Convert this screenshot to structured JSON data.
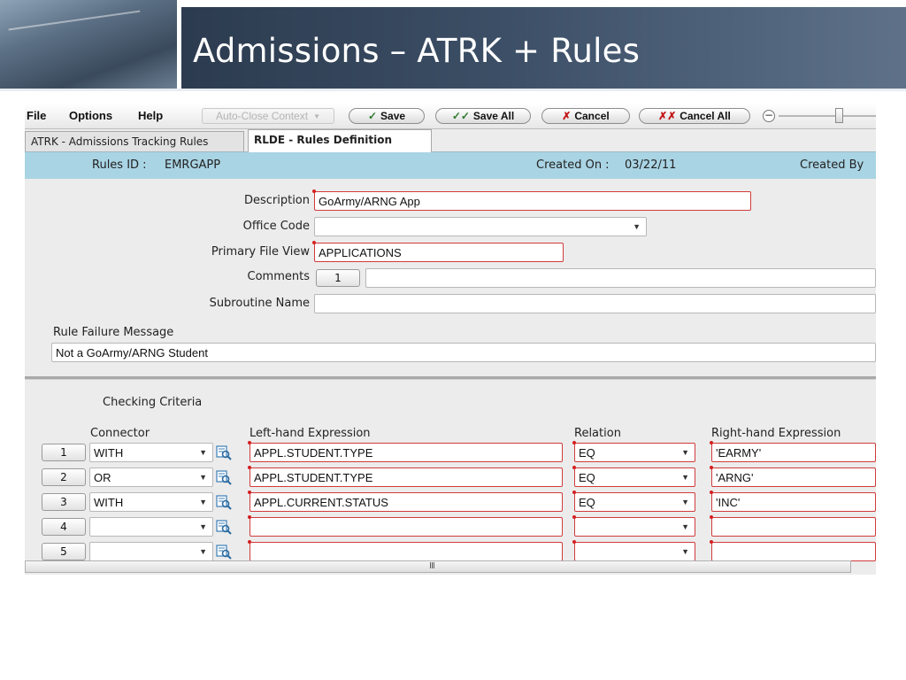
{
  "slide": {
    "title": "Admissions – ATRK + Rules"
  },
  "menu": {
    "file": "File",
    "options": "Options",
    "help": "Help"
  },
  "toolbar": {
    "auto_close": "Auto-Close Context",
    "save": "Save",
    "save_all": "Save All",
    "cancel": "Cancel",
    "cancel_all": "Cancel All",
    "collapse": "−"
  },
  "tabs": [
    {
      "label": "ATRK - Admissions Tracking Rules"
    },
    {
      "label": "RLDE - Rules Definition"
    }
  ],
  "header": {
    "rules_id_label": "Rules ID :",
    "rules_id": "EMRGAPP",
    "created_on_label": "Created On :",
    "created_on": "03/22/11",
    "created_by_label": "Created By"
  },
  "form": {
    "description_label": "Description",
    "description": "GoArmy/ARNG App",
    "office_code_label": "Office Code",
    "office_code": "",
    "primary_file_view_label": "Primary File View",
    "primary_file_view": "APPLICATIONS",
    "comments_label": "Comments",
    "comments_count": "1",
    "comments": "",
    "subroutine_name_label": "Subroutine Name",
    "subroutine_name": "",
    "rule_failure_message_label": "Rule Failure Message",
    "rule_failure_message": "Not a GoArmy/ARNG Student"
  },
  "criteria": {
    "title": "Checking Criteria",
    "headers": {
      "connector": "Connector",
      "left": "Left-hand Expression",
      "relation": "Relation",
      "right": "Right-hand Expression"
    },
    "rows": [
      {
        "num": "1",
        "connector": "WITH",
        "left": "APPL.STUDENT.TYPE",
        "relation": "EQ",
        "right": "'EARMY'"
      },
      {
        "num": "2",
        "connector": "OR",
        "left": "APPL.STUDENT.TYPE",
        "relation": "EQ",
        "right": "'ARNG'"
      },
      {
        "num": "3",
        "connector": "WITH",
        "left": "APPL.CURRENT.STATUS",
        "relation": "EQ",
        "right": "'INC'"
      },
      {
        "num": "4",
        "connector": "",
        "left": "",
        "relation": "",
        "right": ""
      },
      {
        "num": "5",
        "connector": "",
        "left": "",
        "relation": "",
        "right": ""
      }
    ]
  },
  "scrollbar": {
    "grip": "III"
  }
}
